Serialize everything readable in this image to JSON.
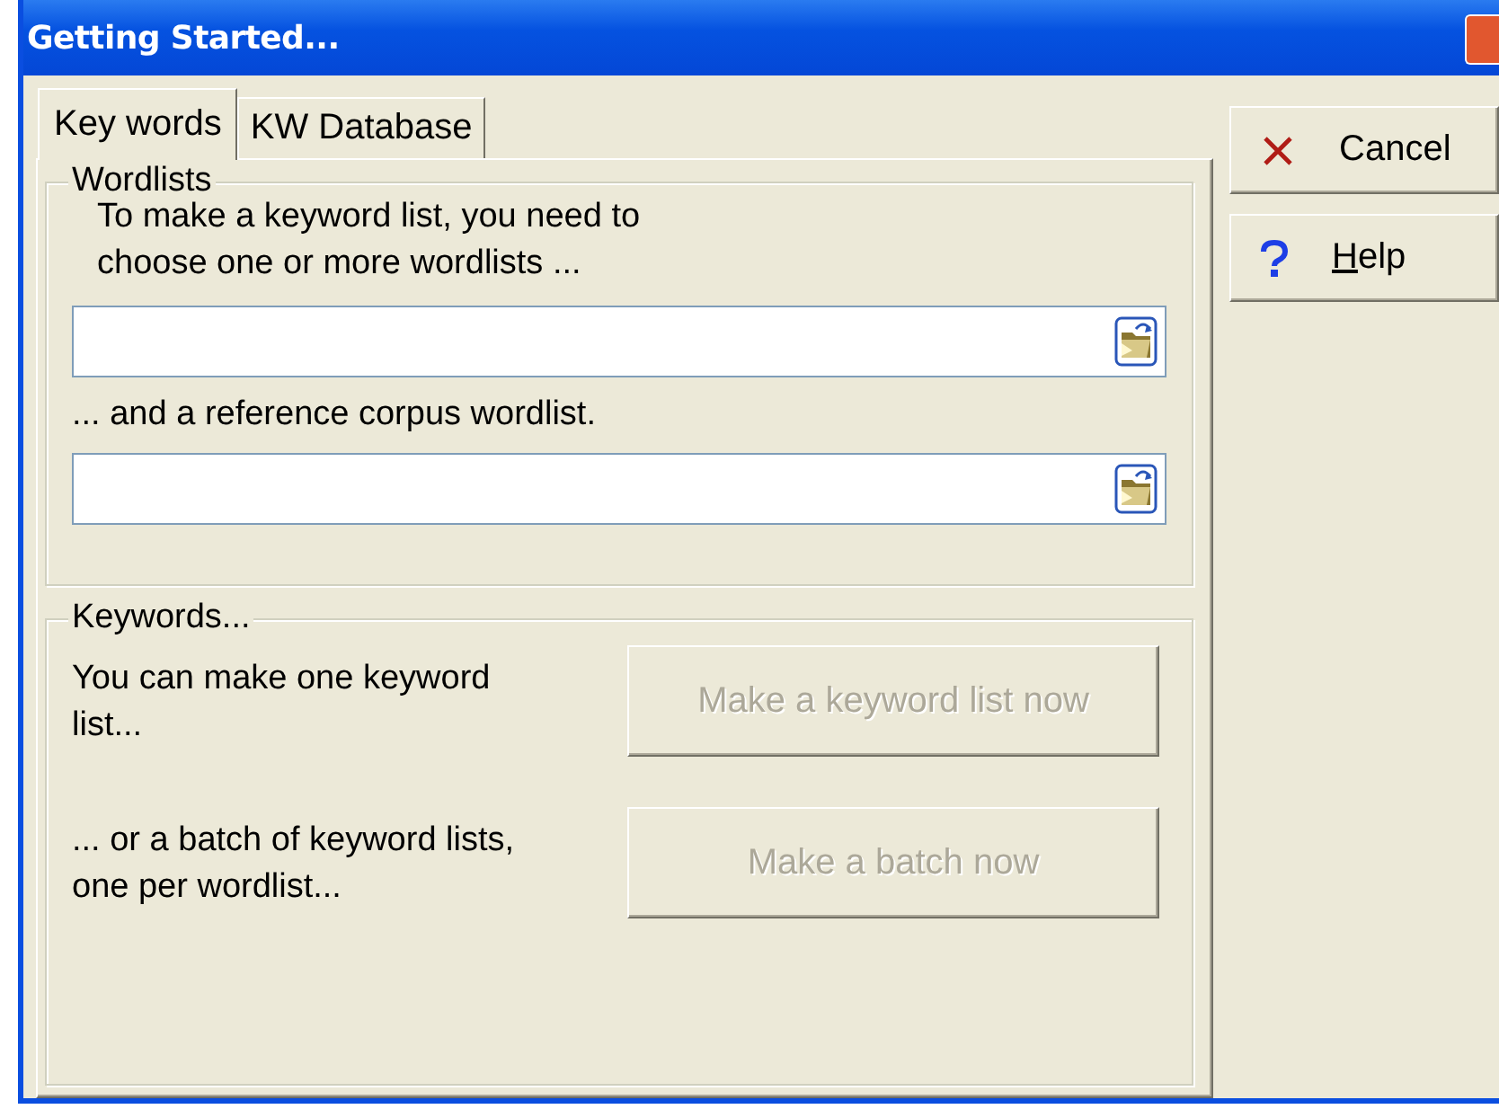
{
  "window": {
    "title": "Getting Started..."
  },
  "tabs": [
    {
      "label": "Key words",
      "selected": true
    },
    {
      "label": "KW Database",
      "selected": false
    }
  ],
  "wordlists": {
    "legend": "Wordlists",
    "steps": [
      {
        "text": "To make a keyword list, you need to choose one or more wordlists ..."
      },
      {
        "text": "... and a reference corpus wordlist."
      }
    ]
  },
  "keywords": {
    "legend": "Keywords...",
    "rows": [
      {
        "text": "You can make one keyword list...",
        "button": {
          "label": "Make a keyword list now",
          "disabled": true
        }
      },
      {
        "text": "... or a batch of keyword lists, one per wordlist...",
        "button": {
          "label": "Make a batch now",
          "disabled": true
        }
      }
    ]
  },
  "side_buttons": [
    {
      "kind": "cancel",
      "label": "Cancel",
      "access_key": false
    },
    {
      "kind": "help",
      "label": "Help",
      "access_key": true
    }
  ]
}
